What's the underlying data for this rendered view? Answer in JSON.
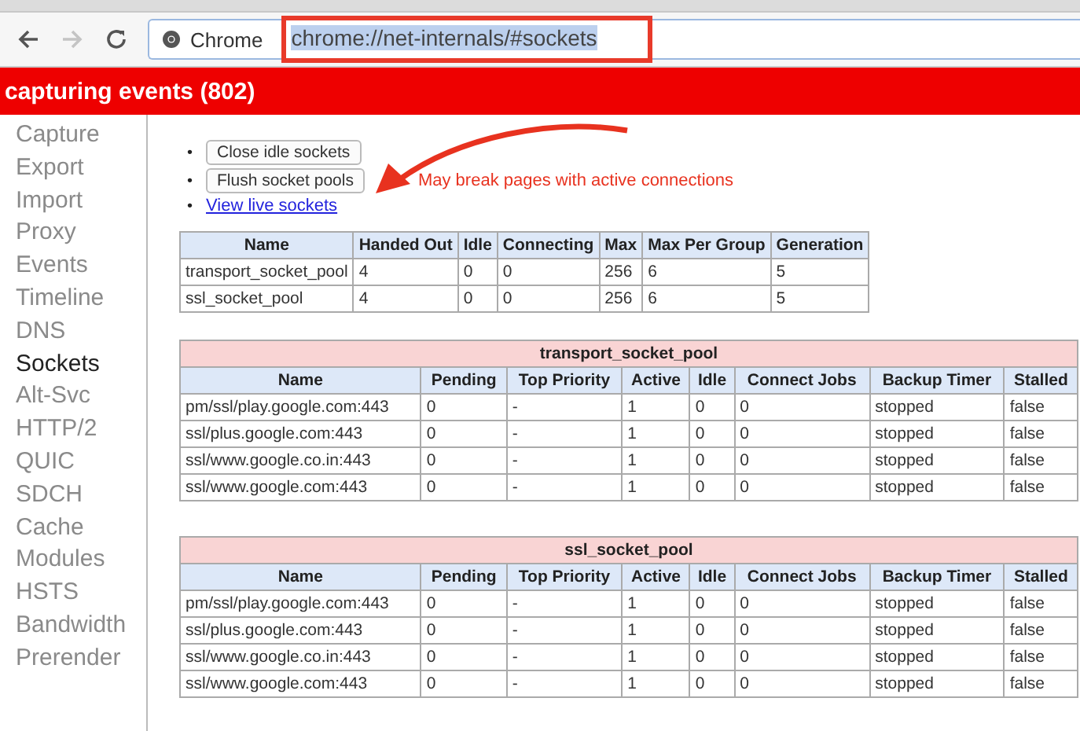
{
  "toolbar": {
    "back": {
      "disabled": false
    },
    "forward": {
      "disabled": true
    },
    "omnibox": {
      "chip": "Chrome",
      "url": "chrome://net-internals/#sockets",
      "selected": true
    }
  },
  "status_banner": "capturing events (802)",
  "sidebar": {
    "items": [
      {
        "label": "Capture",
        "selected": false
      },
      {
        "label": "Export",
        "selected": false
      },
      {
        "label": "Import",
        "selected": false
      },
      {
        "label": "Proxy",
        "selected": false
      },
      {
        "label": "Events",
        "selected": false
      },
      {
        "label": "Timeline",
        "selected": false
      },
      {
        "label": "DNS",
        "selected": false
      },
      {
        "label": "Sockets",
        "selected": true
      },
      {
        "label": "Alt-Svc",
        "selected": false
      },
      {
        "label": "HTTP/2",
        "selected": false
      },
      {
        "label": "QUIC",
        "selected": false
      },
      {
        "label": "SDCH",
        "selected": false
      },
      {
        "label": "Cache",
        "selected": false
      },
      {
        "label": "Modules",
        "selected": false
      },
      {
        "label": "HSTS",
        "selected": false
      },
      {
        "label": "Bandwidth",
        "selected": false
      },
      {
        "label": "Prerender",
        "selected": false
      }
    ]
  },
  "actions": [
    {
      "kind": "button",
      "marker": "•",
      "label": "Close idle sockets"
    },
    {
      "kind": "button",
      "marker": "•",
      "label": "Flush socket pools",
      "note": "May break pages with active connections"
    },
    {
      "kind": "link",
      "marker": "•",
      "label": "View live sockets"
    }
  ],
  "summary_table": {
    "columns": [
      "Name",
      "Handed Out",
      "Idle",
      "Connecting",
      "Max",
      "Max Per Group",
      "Generation"
    ],
    "rows": [
      [
        "transport_socket_pool",
        "4",
        "0",
        "0",
        "256",
        "6",
        "5"
      ],
      [
        "ssl_socket_pool",
        "4",
        "0",
        "0",
        "256",
        "6",
        "5"
      ]
    ]
  },
  "pool_tables": [
    {
      "title": "transport_socket_pool",
      "columns": [
        "Name",
        "Pending",
        "Top Priority",
        "Active",
        "Idle",
        "Connect Jobs",
        "Backup Timer",
        "Stalled"
      ],
      "rows": [
        [
          "pm/ssl/play.google.com:443",
          "0",
          "-",
          "1",
          "0",
          "0",
          "stopped",
          "false"
        ],
        [
          "ssl/plus.google.com:443",
          "0",
          "-",
          "1",
          "0",
          "0",
          "stopped",
          "false"
        ],
        [
          "ssl/www.google.co.in:443",
          "0",
          "-",
          "1",
          "0",
          "0",
          "stopped",
          "false"
        ],
        [
          "ssl/www.google.com:443",
          "0",
          "-",
          "1",
          "0",
          "0",
          "stopped",
          "false"
        ]
      ]
    },
    {
      "title": "ssl_socket_pool",
      "columns": [
        "Name",
        "Pending",
        "Top Priority",
        "Active",
        "Idle",
        "Connect Jobs",
        "Backup Timer",
        "Stalled"
      ],
      "rows": [
        [
          "pm/ssl/play.google.com:443",
          "0",
          "-",
          "1",
          "0",
          "0",
          "stopped",
          "false"
        ],
        [
          "ssl/plus.google.com:443",
          "0",
          "-",
          "1",
          "0",
          "0",
          "stopped",
          "false"
        ],
        [
          "ssl/www.google.co.in:443",
          "0",
          "-",
          "1",
          "0",
          "0",
          "stopped",
          "false"
        ],
        [
          "ssl/www.google.com:443",
          "0",
          "-",
          "1",
          "0",
          "0",
          "stopped",
          "false"
        ]
      ]
    }
  ]
}
